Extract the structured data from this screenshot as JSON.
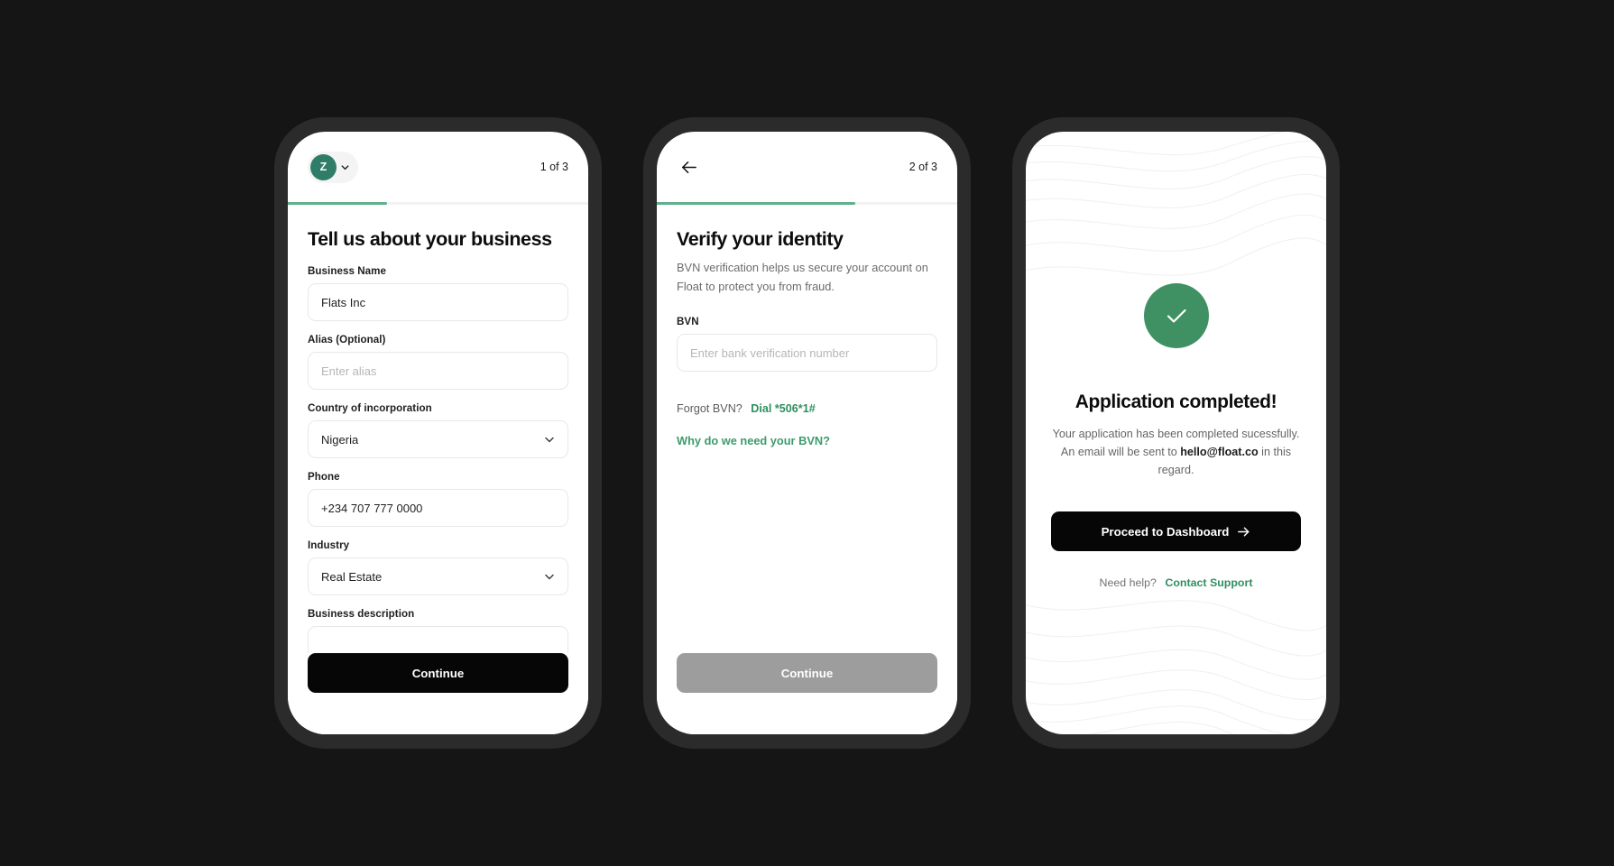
{
  "theme": {
    "background": "#151515",
    "frame": "#2b2b2b",
    "accent_green": "#2f8f5f",
    "progress_green": "#5fb08c",
    "avatar_green": "#2f7d68",
    "success_green": "#3f9163",
    "button_black": "#060606",
    "button_disabled_gray": "#9d9d9d"
  },
  "screens": [
    {
      "id": "business-details",
      "topbar": {
        "avatar_initial": "Z",
        "avatar_chevron_icon": "chevron-down-icon",
        "step_counter": "1 of 3"
      },
      "progress_percent": 33,
      "title": "Tell us about your business",
      "fields": [
        {
          "label": "Business Name",
          "value": "Flats Inc",
          "placeholder": "",
          "type": "text"
        },
        {
          "label": "Alias (Optional)",
          "value": "",
          "placeholder": "Enter alias",
          "type": "text"
        },
        {
          "label": "Country of incorporation",
          "value": "Nigeria",
          "placeholder": "",
          "type": "select"
        },
        {
          "label": "Phone",
          "value": "+234 707 777 0000",
          "placeholder": "",
          "type": "text"
        },
        {
          "label": "Industry",
          "value": "Real Estate",
          "placeholder": "",
          "type": "select"
        },
        {
          "label": "Business description",
          "value": "",
          "placeholder": "",
          "type": "textarea"
        }
      ],
      "cta": {
        "label": "Continue",
        "state": "enabled"
      }
    },
    {
      "id": "verify-identity",
      "topbar": {
        "back_icon": "arrow-left-icon",
        "step_counter": "2 of 3"
      },
      "progress_percent": 66,
      "title": "Verify your identity",
      "subtitle": "BVN verification helps us secure your account on Float to protect you from fraud.",
      "bvn_label": "BVN",
      "bvn_placeholder": "Enter bank verification number",
      "bvn_value": "",
      "forgot_prefix": "Forgot BVN?",
      "forgot_link": "Dial *506*1#",
      "why_link": "Why do we need your BVN?",
      "cta": {
        "label": "Continue",
        "state": "disabled"
      }
    },
    {
      "id": "application-completed",
      "check_icon": "check-icon",
      "title": "Application completed!",
      "message_part1": "Your application has been completed sucessfully. An email will be sent to ",
      "message_email": "hello@float.co",
      "message_part2": " in this regard.",
      "cta": {
        "label": "Proceed to Dashboard",
        "arrow_icon": "arrow-right-icon"
      },
      "help_prefix": "Need help?",
      "help_link": "Contact Support"
    }
  ]
}
